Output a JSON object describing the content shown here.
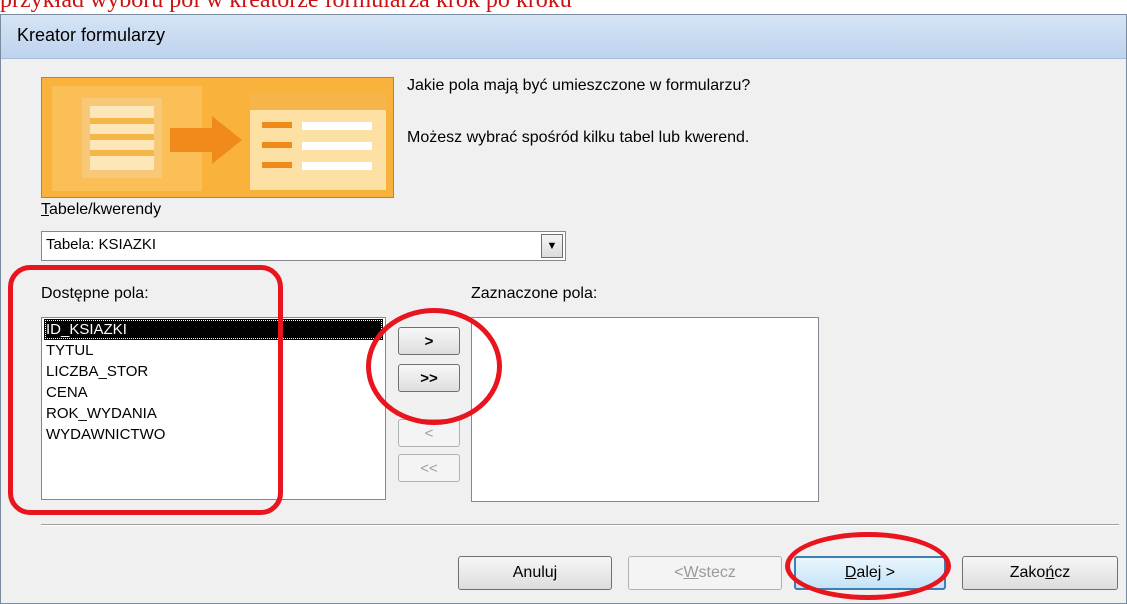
{
  "page_caption": "przykład wyboru pól w kreatorze formularza krok po kroku",
  "dialog": {
    "title": "Kreator formularzy",
    "question": "Jakie pola mają być umieszczone w formularzu?",
    "hint": "Możesz wybrać spośród kilku tabel lub kwerend."
  },
  "tables": {
    "label": "Tabele/kwerendy",
    "selected": "Tabela: KSIAZKI"
  },
  "available": {
    "label": "Dostępne pola:",
    "items": [
      "ID_KSIAZKI",
      "TYTUL",
      "LICZBA_STOR",
      "CENA",
      "ROK_WYDANIA",
      "WYDAWNICTWO"
    ],
    "selected_index": 0
  },
  "selected_fields": {
    "label": "Zaznaczone pola:",
    "items": []
  },
  "move_buttons": {
    "add_one": ">",
    "add_all": ">>",
    "remove_one": "<",
    "remove_all": "<<"
  },
  "footer": {
    "cancel": "Anuluj",
    "back": "< Wstecz",
    "next": "Dalej >",
    "finish": "Zakończ"
  },
  "colors": {
    "annotation_red": "#e8141e",
    "wizard_orange": "#f7a52a",
    "titlebar": "#c9dbf2"
  }
}
